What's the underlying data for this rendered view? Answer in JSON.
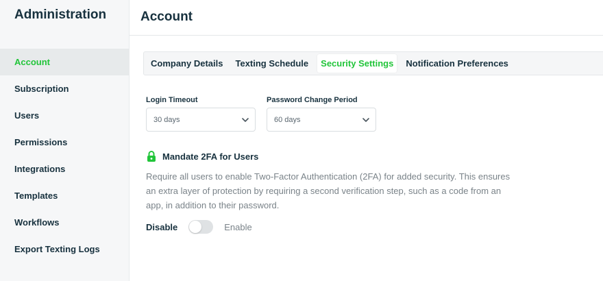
{
  "sidebar": {
    "title": "Administration",
    "items": [
      {
        "label": "Account",
        "active": true
      },
      {
        "label": "Subscription",
        "active": false
      },
      {
        "label": "Users",
        "active": false
      },
      {
        "label": "Permissions",
        "active": false
      },
      {
        "label": "Integrations",
        "active": false
      },
      {
        "label": "Templates",
        "active": false
      },
      {
        "label": "Workflows",
        "active": false
      },
      {
        "label": "Export Texting Logs",
        "active": false
      }
    ]
  },
  "header": {
    "title": "Account"
  },
  "tabs": [
    {
      "label": "Company Details",
      "active": false
    },
    {
      "label": "Texting Schedule",
      "active": false
    },
    {
      "label": "Security Settings",
      "active": true
    },
    {
      "label": "Notification Preferences",
      "active": false
    }
  ],
  "security": {
    "login_timeout": {
      "label": "Login Timeout",
      "value": "30 days"
    },
    "password_change": {
      "label": "Password Change Period",
      "value": "60 days"
    },
    "mfa": {
      "title": "Mandate 2FA for Users",
      "icon": "lock-icon",
      "description": "Require all users to enable Two-Factor Authentication (2FA) for added security. This ensures an extra layer of protection by requiring a second verification step, such as a code from an app, in addition to their password.",
      "toggle_off_label": "Disable",
      "toggle_on_label": "Enable",
      "enabled": false
    }
  },
  "colors": {
    "accent": "#22c53a",
    "text_dark": "#17313e",
    "text_muted": "#7a8389",
    "sidebar_bg": "#f6f7f8"
  }
}
